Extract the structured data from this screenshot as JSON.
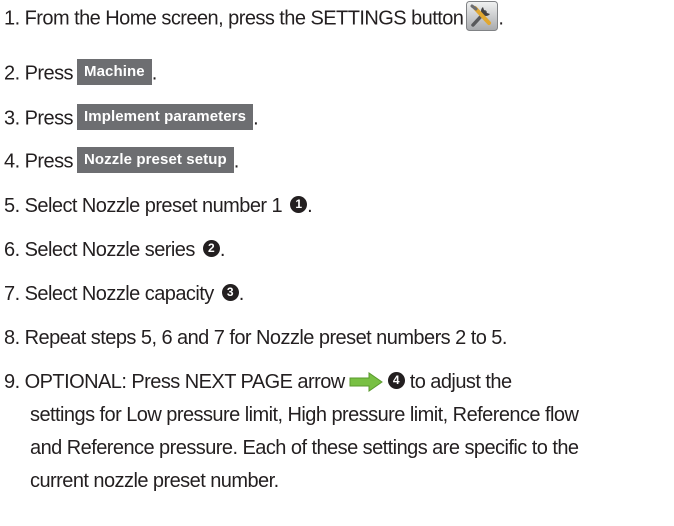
{
  "steps": [
    {
      "num": "1.",
      "pre": "From the Home screen, press the SETTINGS button",
      "post": ".",
      "icon": "settings-wrench-screwdriver-icon"
    },
    {
      "num": "2.",
      "pre": "Press",
      "button": "Machine",
      "post": "."
    },
    {
      "num": "3.",
      "pre": "Press",
      "button": "Implement parameters",
      "post": "."
    },
    {
      "num": "4.",
      "pre": "Press",
      "button": "Nozzle preset setup",
      "post": "."
    },
    {
      "num": "5.",
      "pre": "Select Nozzle preset number 1",
      "callout": "1",
      "post": "."
    },
    {
      "num": "6.",
      "pre": "Select Nozzle series",
      "callout": "2",
      "post": "."
    },
    {
      "num": "7.",
      "pre": "Select Nozzle capacity",
      "callout": "3",
      "post": "."
    },
    {
      "num": "8.",
      "text": "Repeat steps 5, 6 and 7 for Nozzle preset numbers 2 to 5."
    },
    {
      "num": "9.",
      "pre": "OPTIONAL: Press NEXT PAGE arrow",
      "icon": "next-page-arrow-icon",
      "callout": "4",
      "post": "to adjust the",
      "lines": [
        "settings for Low pressure limit, High pressure limit, Reference flow",
        "and Reference pressure. Each of these settings are specific to the",
        "current nozzle preset number."
      ]
    }
  ],
  "colors": {
    "text": "#231f20",
    "button_bg": "#6d6e71",
    "button_text": "#ffffff",
    "callout_bg": "#231f20",
    "arrow_green": "#78c043"
  }
}
